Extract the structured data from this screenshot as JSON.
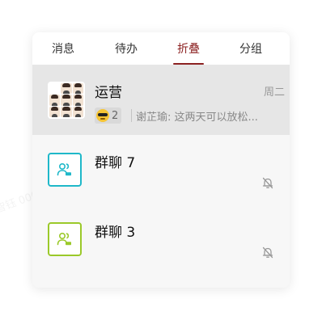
{
  "tabs": [
    {
      "label": "消息",
      "active": false
    },
    {
      "label": "待办",
      "active": false
    },
    {
      "label": "折叠",
      "active": true
    },
    {
      "label": "分组",
      "active": false
    }
  ],
  "conversations": [
    {
      "title": "运营",
      "time": "周二",
      "reaction_count": "2",
      "preview": "谢芷瑜: 这两天可以放松...",
      "selected": true
    },
    {
      "title": "群聊 7",
      "icon_color": "#1fb8c9",
      "muted": true
    },
    {
      "title": "群聊 3",
      "icon_color": "#9bc92a",
      "muted": true
    }
  ],
  "watermark": "王智钰 0000",
  "colors": {
    "accent": "#8c2222",
    "selected_row": "#e6e6e6",
    "panel_bg": "#f7f7f7"
  }
}
